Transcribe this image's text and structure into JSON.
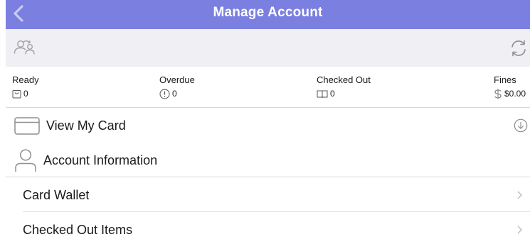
{
  "header": {
    "title": "Manage Account",
    "back_icon": "chevron-left-icon"
  },
  "toolbar": {
    "switch_icon": "switch-accounts-icon",
    "refresh_icon": "refresh-icon"
  },
  "stats": {
    "ready": {
      "label": "Ready",
      "value": "0",
      "icon": "bag-icon"
    },
    "overdue": {
      "label": "Overdue",
      "value": "0",
      "icon": "alert-circle-icon"
    },
    "checked_out": {
      "label": "Checked Out",
      "value": "0",
      "icon": "book-open-icon"
    },
    "fines": {
      "label": "Fines",
      "value": "$0.00",
      "icon": "dollar-icon"
    }
  },
  "menu": {
    "view_card": {
      "label": "View My Card",
      "icon": "card-icon",
      "action_icon": "arrow-down-circle-icon"
    },
    "account_info": {
      "label": "Account Information",
      "icon": "person-icon"
    },
    "items": [
      {
        "label": "Card Wallet"
      },
      {
        "label": "Checked Out Items"
      }
    ]
  },
  "colors": {
    "header_bg": "#7a7fe0",
    "toolbar_bg": "#efeff4",
    "icon_gray": "#8e8e93"
  }
}
